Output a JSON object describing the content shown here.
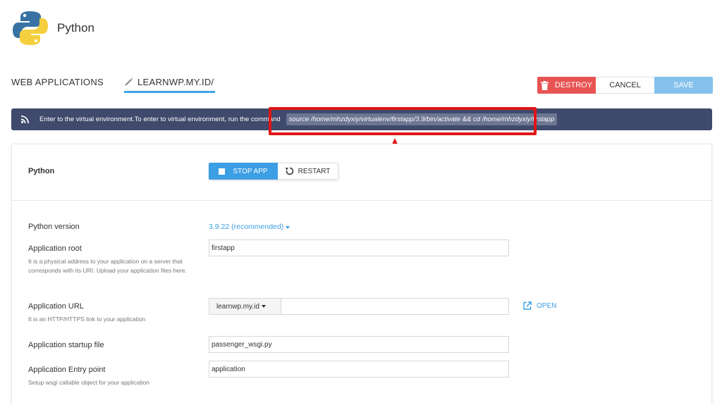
{
  "header": {
    "title": "Python",
    "logo_icon": "python-logo"
  },
  "breadcrumb": {
    "root": "WEB APPLICATIONS",
    "current": "LEARNWP.MY.ID/",
    "current_icon": "pencil-icon"
  },
  "actions": {
    "destroy_label": "DESTROY",
    "cancel_label": "CANCEL",
    "save_label": "SAVE"
  },
  "banner": {
    "icon": "rss-icon",
    "message": "Enter to the virtual environment.To enter to virtual environment, run the command",
    "command": "source /home/mhzdyxiy/virtualenv/firstapp/3.9/bin/activate && cd /home/mhzdyxiy/firstapp"
  },
  "app_panel": {
    "section_title": "Python",
    "stop_label": "STOP APP",
    "restart_label": "RESTART",
    "python_version": {
      "label": "Python version",
      "value": "3.9.22 (recommended)"
    },
    "app_root": {
      "label": "Application root",
      "hint": "It is a physical address to your application on a server that corresponds with its URI. Upload your application files here.",
      "value": "firstapp"
    },
    "app_url": {
      "label": "Application URL",
      "hint": "It is an HTTP/HTTPS link to your application",
      "domain": "learnwp.my.id",
      "path": "",
      "open_label": "OPEN"
    },
    "startup_file": {
      "label": "Application startup file",
      "value": "passenger_wsgi.py"
    },
    "entry_point": {
      "label": "Application Entry point",
      "hint": "Setup wsgi callable object for your application",
      "value": "application"
    }
  },
  "colors": {
    "accent": "#3c9ee4",
    "destroy": "#e85454",
    "banner": "#3f4a6c",
    "annotation": "#e01616"
  }
}
